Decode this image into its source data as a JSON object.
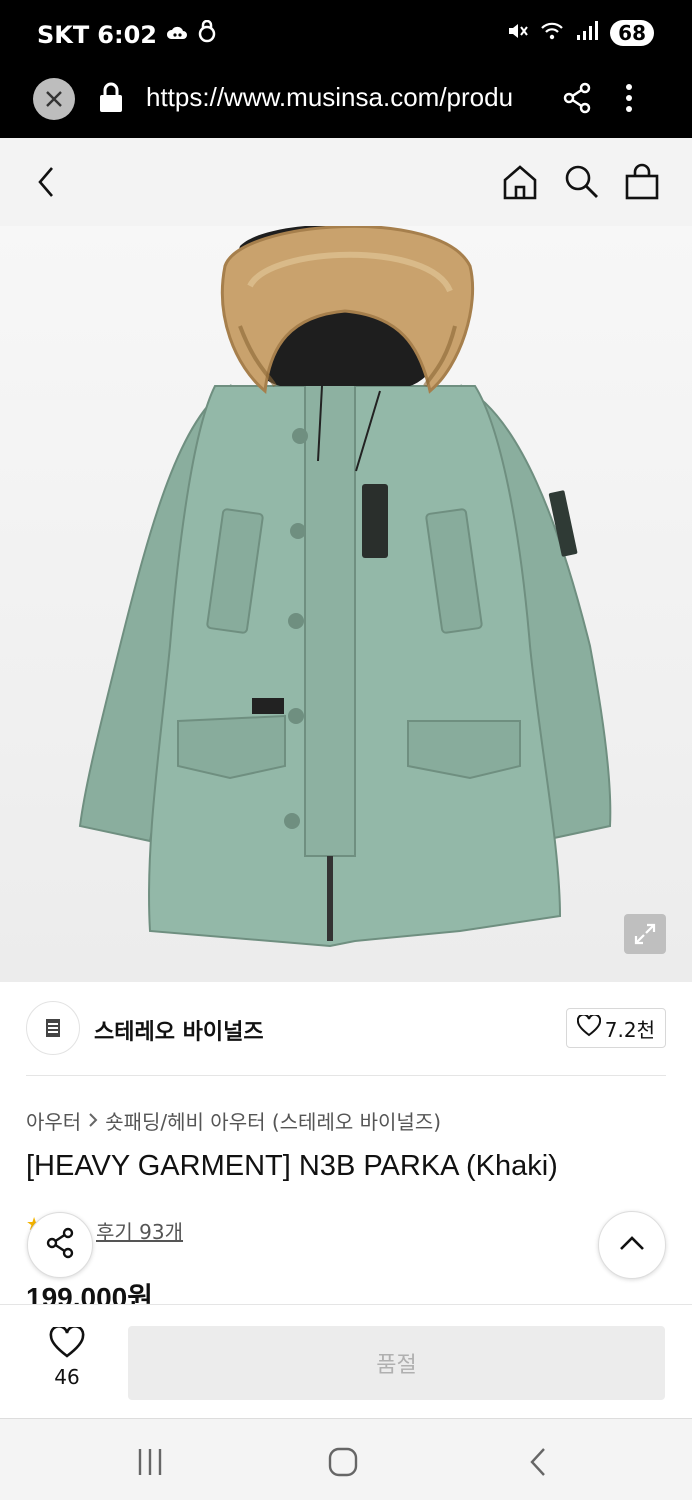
{
  "status_bar": {
    "carrier": "SKT",
    "time": "6:02",
    "battery": "68",
    "icons": [
      "cloud-icon",
      "lock-app-icon",
      "mute-icon",
      "wifi-icon",
      "signal-icon",
      "battery-icon"
    ]
  },
  "browser": {
    "url": "https://www.musinsa.com/produ",
    "icons": [
      "close-icon",
      "lock-icon",
      "share-icon",
      "more-vert-icon"
    ]
  },
  "header": {
    "icons": [
      "back-icon",
      "home-icon",
      "search-icon",
      "shopping-bag-icon"
    ]
  },
  "product": {
    "image_alt": "Khaki N3B parka with fur-trimmed hood",
    "brand": "스테레오 바이널즈",
    "brand_likes": "7.2천",
    "breadcrumb": [
      "아우터",
      "숏패딩/헤비 아우터 (스테레오 바이널즈)"
    ],
    "title": "[HEAVY GARMENT] N3B PARKA (Khaki)",
    "review_link": "후기 93개",
    "price": "199,000원"
  },
  "bottom_bar": {
    "wish_count": "46",
    "buy_label": "품절"
  },
  "colors": {
    "jacket": "#8fb3a3",
    "fur": "#c8a574",
    "disabled_button": "#ececec",
    "star": "#f4b400"
  }
}
